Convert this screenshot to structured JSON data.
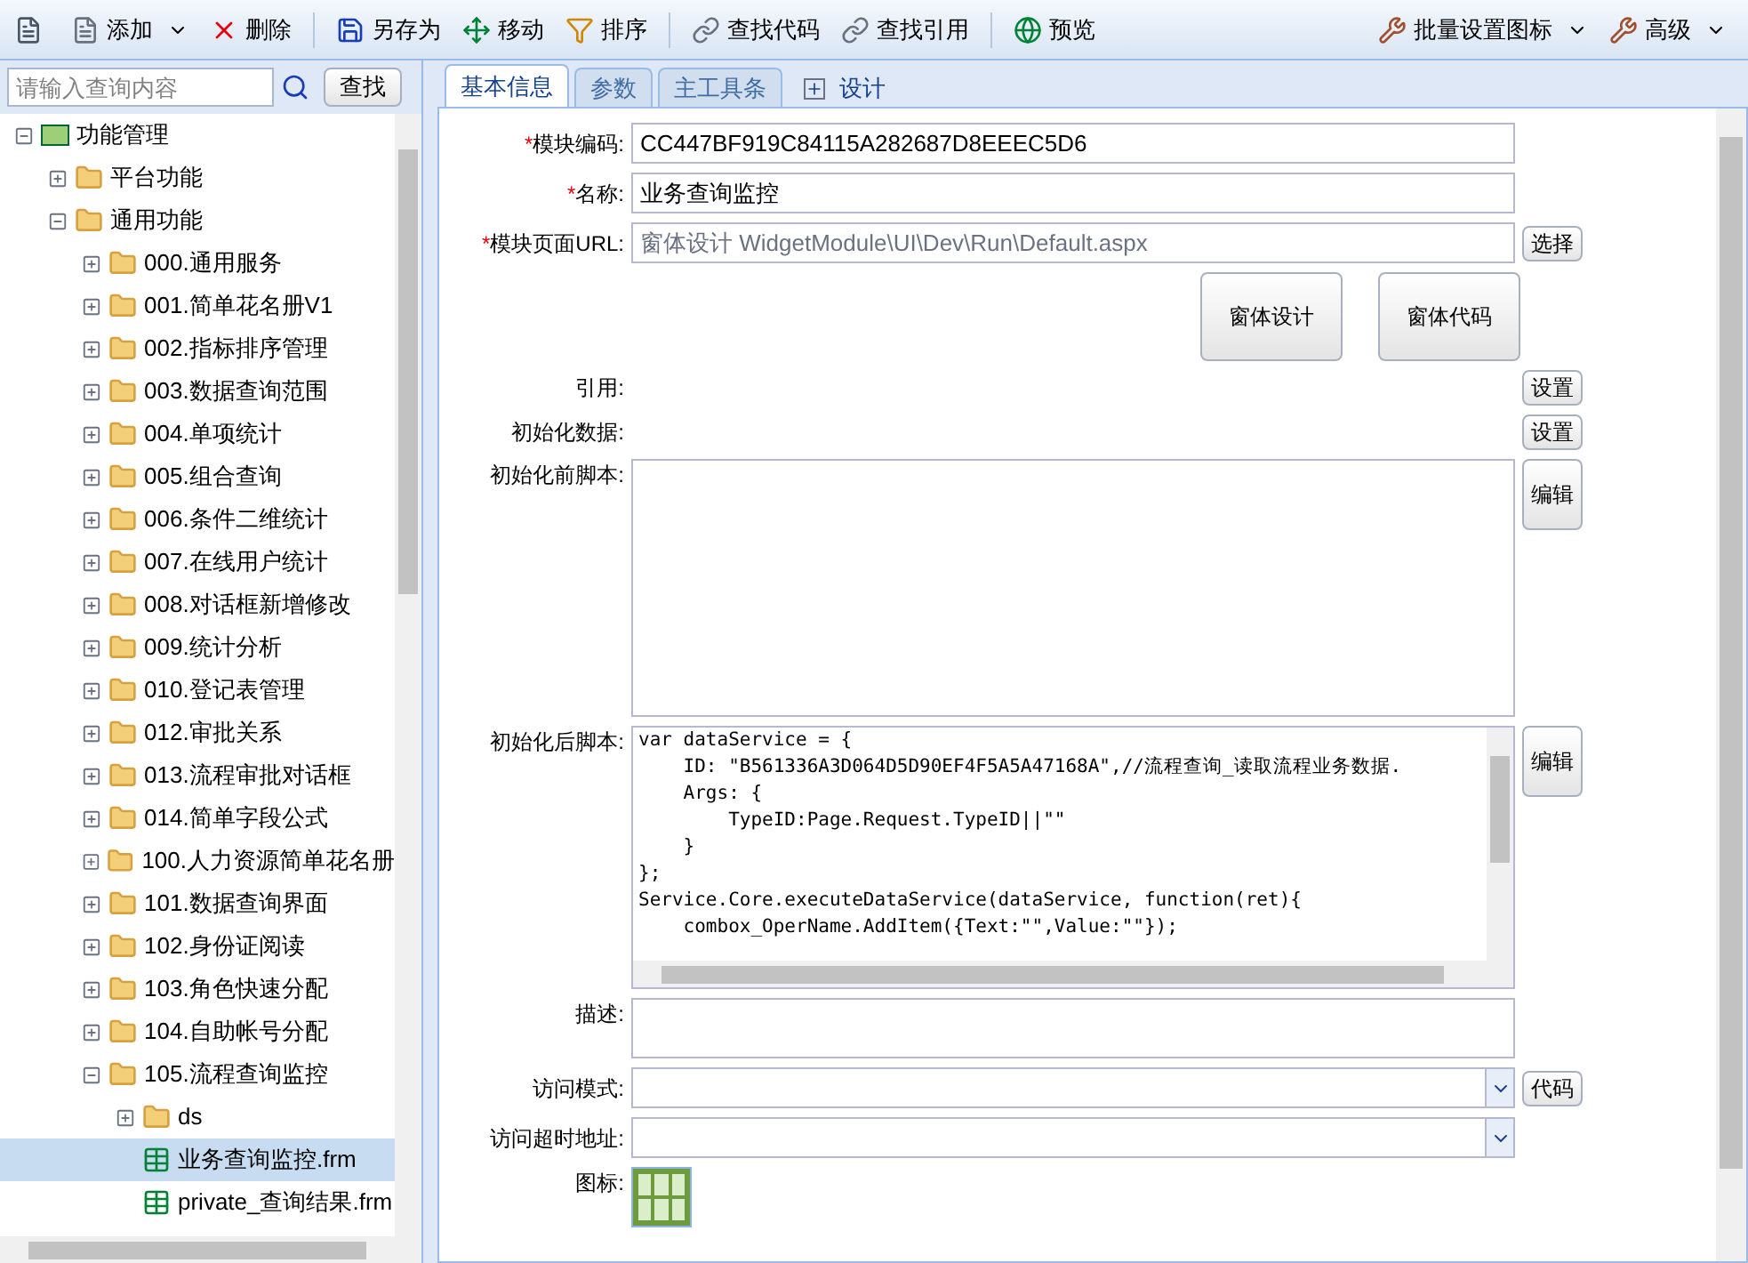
{
  "toolbar": {
    "left": [
      {
        "label": "添加",
        "dropdown": true
      },
      {
        "label": "删除",
        "dropdown": false
      },
      {
        "label": "另存为",
        "dropdown": false
      },
      {
        "label": "移动",
        "dropdown": false
      },
      {
        "label": "排序",
        "dropdown": false
      },
      {
        "label": "查找代码",
        "dropdown": false
      },
      {
        "label": "查找引用",
        "dropdown": false
      },
      {
        "label": "预览",
        "dropdown": false
      }
    ],
    "right": [
      {
        "label": "批量设置图标",
        "dropdown": true
      },
      {
        "label": "高级",
        "dropdown": true
      }
    ]
  },
  "search": {
    "placeholder": "请输入查询内容",
    "button": "查找"
  },
  "tree": [
    {
      "label": "功能管理",
      "kind": "root",
      "expanded": true,
      "selected": false,
      "children": [
        {
          "label": "平台功能",
          "kind": "folder",
          "expanded": false,
          "selected": false
        },
        {
          "label": "通用功能",
          "kind": "folder",
          "expanded": true,
          "selected": false,
          "children": [
            {
              "label": "000.通用服务",
              "kind": "folder",
              "expanded": false,
              "selected": false
            },
            {
              "label": "001.简单花名册V1",
              "kind": "folder",
              "expanded": false,
              "selected": false
            },
            {
              "label": "002.指标排序管理",
              "kind": "folder",
              "expanded": false,
              "selected": false
            },
            {
              "label": "003.数据查询范围",
              "kind": "folder",
              "expanded": false,
              "selected": false
            },
            {
              "label": "004.单项统计",
              "kind": "folder",
              "expanded": false,
              "selected": false
            },
            {
              "label": "005.组合查询",
              "kind": "folder",
              "expanded": false,
              "selected": false
            },
            {
              "label": "006.条件二维统计",
              "kind": "folder",
              "expanded": false,
              "selected": false
            },
            {
              "label": "007.在线用户统计",
              "kind": "folder",
              "expanded": false,
              "selected": false
            },
            {
              "label": "008.对话框新增修改",
              "kind": "folder",
              "expanded": false,
              "selected": false
            },
            {
              "label": "009.统计分析",
              "kind": "folder",
              "expanded": false,
              "selected": false
            },
            {
              "label": "010.登记表管理",
              "kind": "folder",
              "expanded": false,
              "selected": false
            },
            {
              "label": "012.审批关系",
              "kind": "folder",
              "expanded": false,
              "selected": false
            },
            {
              "label": "013.流程审批对话框",
              "kind": "folder",
              "expanded": false,
              "selected": false
            },
            {
              "label": "014.简单字段公式",
              "kind": "folder",
              "expanded": false,
              "selected": false
            },
            {
              "label": "100.人力资源简单花名册",
              "kind": "folder",
              "expanded": false,
              "selected": false
            },
            {
              "label": "101.数据查询界面",
              "kind": "folder",
              "expanded": false,
              "selected": false
            },
            {
              "label": "102.身份证阅读",
              "kind": "folder",
              "expanded": false,
              "selected": false
            },
            {
              "label": "103.角色快速分配",
              "kind": "folder",
              "expanded": false,
              "selected": false
            },
            {
              "label": "104.自助帐号分配",
              "kind": "folder",
              "expanded": false,
              "selected": false
            },
            {
              "label": "105.流程查询监控",
              "kind": "folder",
              "expanded": true,
              "selected": false,
              "children": [
                {
                  "label": "ds",
                  "kind": "folder",
                  "expanded": false,
                  "selected": false
                },
                {
                  "label": "业务查询监控.frm",
                  "kind": "file",
                  "selected": true
                },
                {
                  "label": "private_查询结果.frm",
                  "kind": "file",
                  "selected": false
                }
              ]
            }
          ]
        }
      ]
    }
  ],
  "tabs": [
    {
      "label": "基本信息",
      "selected": true
    },
    {
      "label": "参数",
      "selected": false
    },
    {
      "label": "主工具条",
      "selected": false
    },
    {
      "label": "设计",
      "selected": false
    }
  ],
  "form": {
    "code": {
      "label": "模块编码:",
      "required": true,
      "mark": "*",
      "value": "CC447BF919C84115A282687D8EEEC5D6"
    },
    "name": {
      "label": "名称:",
      "required": true,
      "mark": "*",
      "value": "业务查询监控"
    },
    "url": {
      "label": "模块页面URL:",
      "required": true,
      "mark": "*",
      "disabled": true,
      "value": "窗体设计 WidgetModule\\UI\\Dev\\Run\\Default.aspx",
      "button": "选择"
    },
    "big_buttons": [
      "窗体设计",
      "窗体代码"
    ],
    "reference": {
      "label": "引用:",
      "button": "设置"
    },
    "init_data": {
      "label": "初始化数据:",
      "button": "设置"
    },
    "pre_script": {
      "label": "初始化前脚本:",
      "button": "编辑"
    },
    "post_script": {
      "label": "初始化后脚本:",
      "button": "编辑",
      "lines": [
        "var dataService = {",
        "    ID: \"B561336A3D064D5D90EF4F5A5A47168A\",//流程查询_读取流程业务数据.",
        "    Args: {",
        "        TypeID:Page.Request.TypeID||\"\"",
        "    }",
        "};",
        "Service.Core.executeDataService(dataService, function(ret){",
        "    combox_OperName.AddItem({Text:\"\",Value:\"\"});"
      ]
    },
    "description": {
      "label": "描述:"
    },
    "access_mode": {
      "label": "访问模式:",
      "button": "代码"
    },
    "timeout_url": {
      "label": "访问超时地址:"
    },
    "icon": {
      "label": "图标:"
    }
  }
}
